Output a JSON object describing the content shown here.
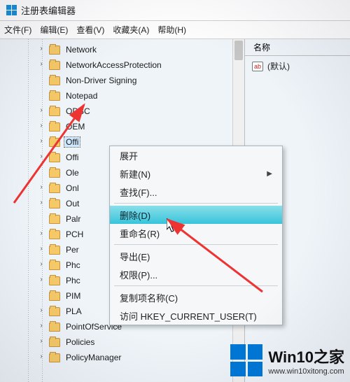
{
  "window": {
    "title": "注册表编辑器"
  },
  "menubar": {
    "file": "文件(F)",
    "edit": "编辑(E)",
    "view": "查看(V)",
    "favorites": "收藏夹(A)",
    "help": "帮助(H)"
  },
  "tree": {
    "items": [
      {
        "label": "Network"
      },
      {
        "label": "NetworkAccessProtection"
      },
      {
        "label": "Non-Driver Signing"
      },
      {
        "label": "Notepad"
      },
      {
        "label": "ODBC"
      },
      {
        "label": "OEM"
      },
      {
        "label": "Offi",
        "selected": true
      },
      {
        "label": "Offi"
      },
      {
        "label": "Ole"
      },
      {
        "label": "Onl"
      },
      {
        "label": "Out"
      },
      {
        "label": "Palr"
      },
      {
        "label": "PCH"
      },
      {
        "label": "Per"
      },
      {
        "label": "Phc"
      },
      {
        "label": "Phc"
      },
      {
        "label": "PIM"
      },
      {
        "label": "PLA"
      },
      {
        "label": "PointOfService"
      },
      {
        "label": "Policies"
      },
      {
        "label": "PolicyManager"
      }
    ]
  },
  "right": {
    "column_name": "名称",
    "default_item": "(默认)",
    "ab_icon_text": "ab"
  },
  "contextmenu": {
    "expand": "展开",
    "new": "新建(N)",
    "find": "查找(F)...",
    "delete": "删除(D)",
    "rename": "重命名(R)",
    "export": "导出(E)",
    "permissions": "权限(P)...",
    "copykeyname": "复制项名称(C)",
    "goto": "访问 HKEY_CURRENT_USER(T)"
  },
  "watermark": {
    "brand": "Win10之家",
    "url": "www.win10xitong.com"
  }
}
